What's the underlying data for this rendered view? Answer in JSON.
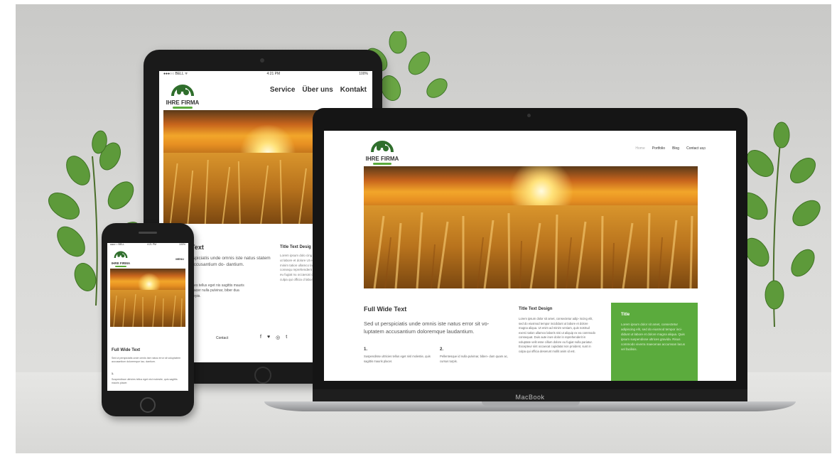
{
  "brand": "IHRE FIRMA",
  "colors": {
    "accent_green": "#5bab3d",
    "device_body": "#1a1a1a"
  },
  "tablet": {
    "status_carrier": "●●●○○ BELL ᯤ",
    "status_time": "4:21 PM",
    "status_battery": "100%",
    "nav": [
      "Service",
      "Über uns",
      "Kontakt"
    ],
    "heading": "Text",
    "lead": "rspiciatis unde omnis iste natus statem accusantium do- dantium.",
    "col2_heading": "Title Text Desig",
    "col2_text": "Lorem ipsum dolo cing elit, sed do ut labore et dolore Ut enim ad minim tation ullamco lab commodo consequ reprehenderit in vo dolore eu fugiat nu occaecat cupidat culpa qui officia d laborum.",
    "small_text": "ntes tellus eget nis sagittis mauris placer nulla pulvinar, biber dua turpis.",
    "footer_label": "Contact",
    "social": [
      "f",
      "♥",
      "◎",
      "t"
    ]
  },
  "laptop": {
    "nav": [
      "Home",
      "Portfolio",
      "Blog",
      "Contact us"
    ],
    "search_icon": "search-icon",
    "heading": "Full Wide Text",
    "lead": "Sed ut perspiciatis unde omnis iste natus error sit vo- luptatem accusantium doloremque laudantium.",
    "num1": "1.",
    "num1_text": "Suspendisse ultricies tellus eget nisl molestie, quis sagittis mauris placer.",
    "num2": "2.",
    "num2_text": "Pellentesque id nulla pulvinar, biben- dum quam ac, cursus turpis.",
    "col2_heading": "Title Text Design",
    "col2_text": "Lorem ipsum dolor sit amet, consectetur adip- iscing elit, sed do eiusmod tempor incididunt ut labore et dolore magna aliqua. Ut enim ad minim veniam, quis nostrud exerci tation ullamco laboris nisi ut aliquip ex ea commodo consequat. Duis aute irure dolor in reprehenderit in voluptate velit esse cillum dolore eu fugiat nulla pariatur. Excepteur sint occaecat cupidatat non proident, sunt in culpa qui officia deserunt mollit anim id est.",
    "green_title": "Title",
    "green_text": "Lorem ipsum dolor sit amet, consectetur adipiscing elit, sed do eiusmod tempor inci- didunt ut labore et dolore magna aliqua. Quis ipsum suspendisse ultrices gravida. Risus commodo viverra maecenas accumsan lacus vel facilisis.",
    "brand_label": "MacBook"
  },
  "phone": {
    "status_carrier": "●●●○○ BELL",
    "status_time": "4:21 PM",
    "status_battery": "100%",
    "menu": "MENU",
    "heading": "Full Wide Text",
    "lead": "Sed ut perspiciatis unde omnis iste natus error sit voluptatem accusantium doloremque lau- dantium.",
    "num": "1.",
    "small_text": "Suspendisse ultricies tellus eget nisl molestie, quis sagittis mauris placer."
  }
}
